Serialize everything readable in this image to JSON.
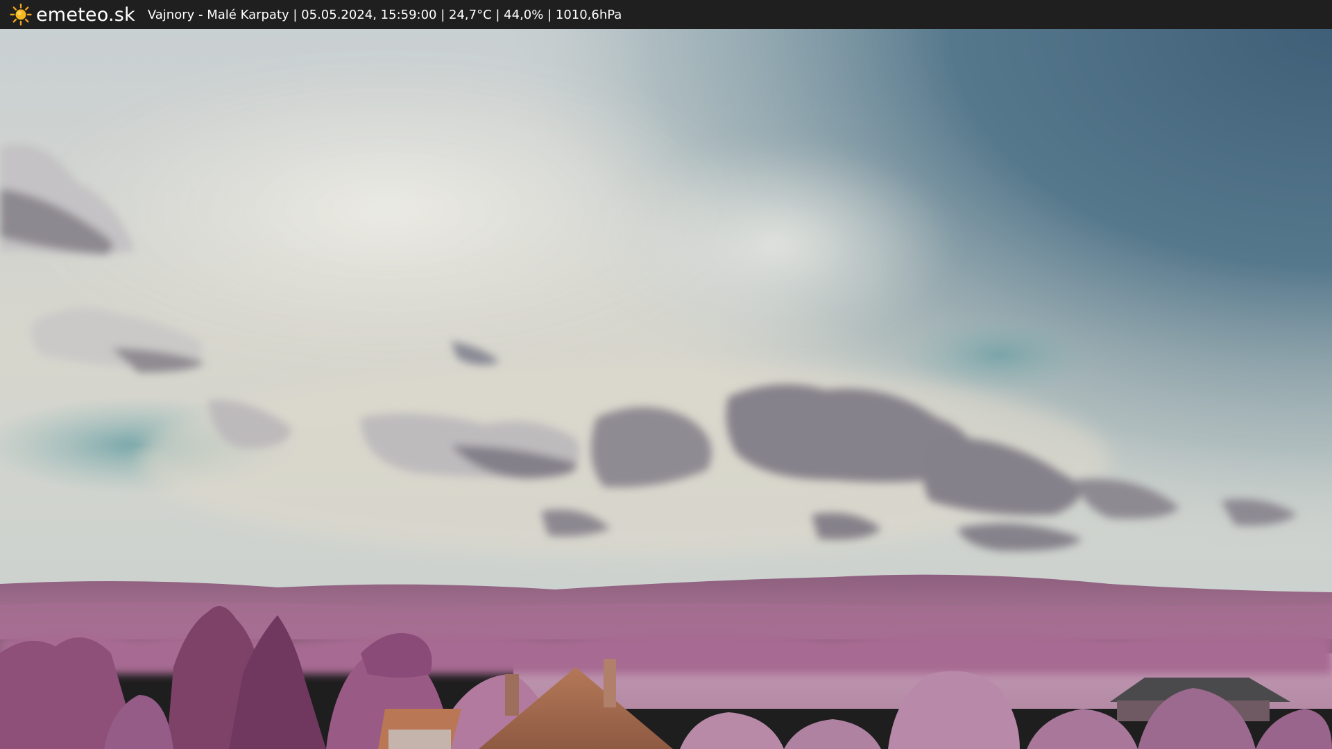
{
  "header": {
    "brand": "emeteo.sk",
    "icon": "sun-icon",
    "station_info": "Vajnory - Malé Karpaty | 05.05.2024, 15:59:00 | 24,7°C | 44,0% | 1010,6hPa"
  },
  "colors": {
    "bar_background": "#1f1f1f",
    "sky_top": "#4d6e86",
    "cloud": "#e6e4dc",
    "vegetation": "#9a5a82",
    "roof": "#a86a4c"
  }
}
